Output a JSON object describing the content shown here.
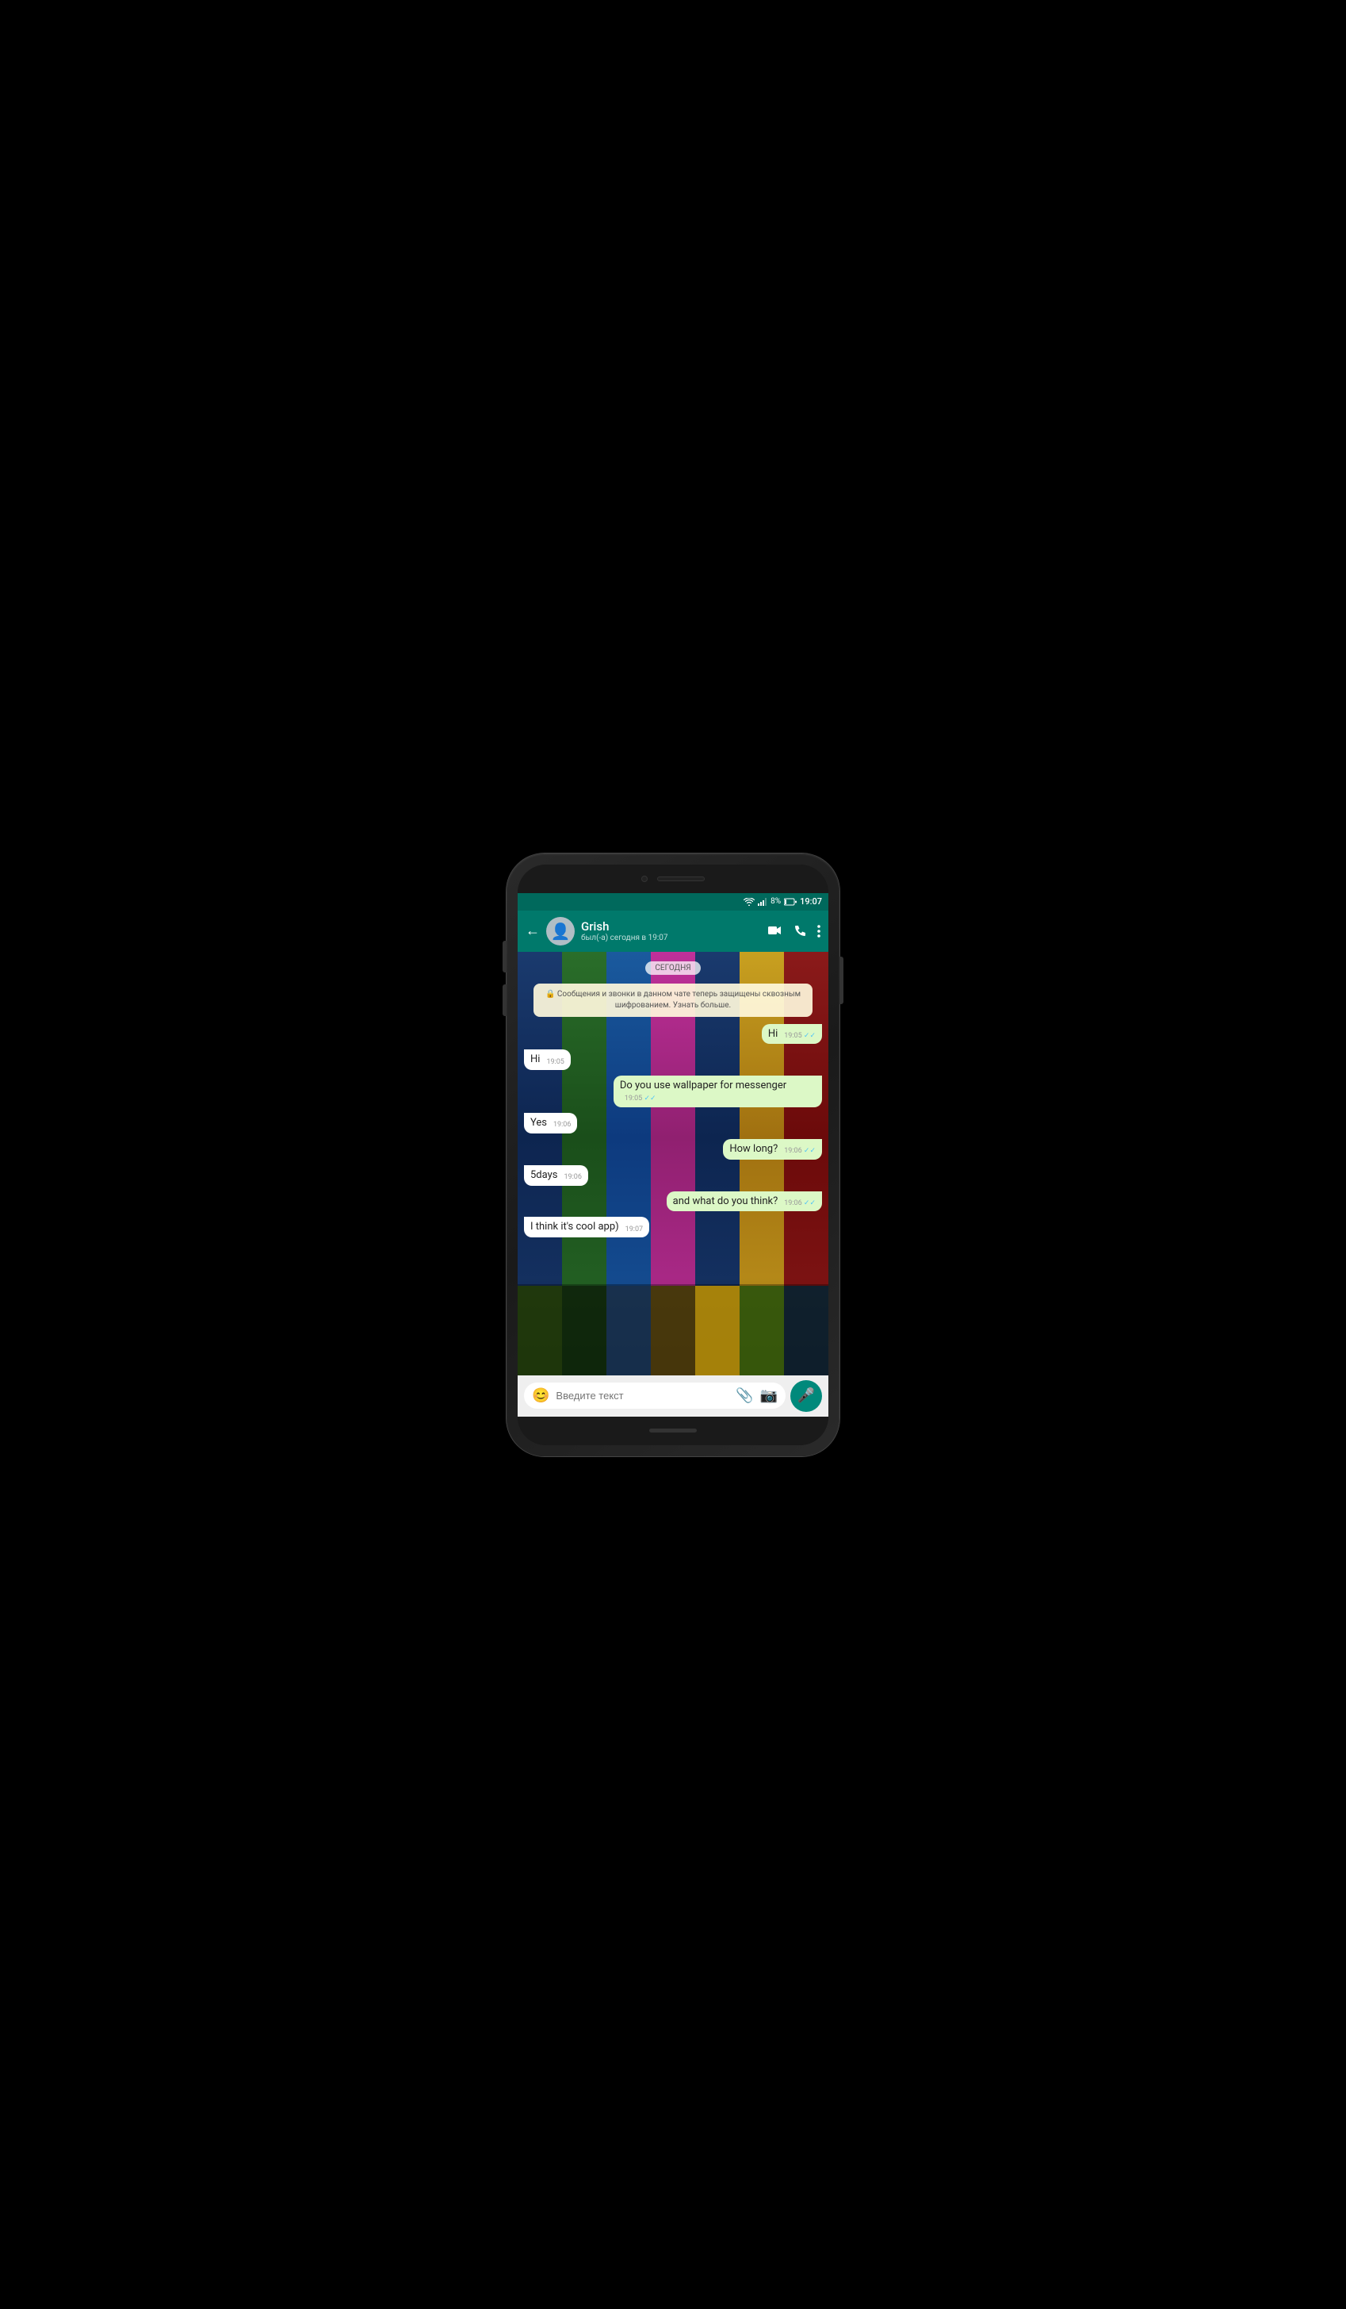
{
  "phone": {
    "statusBar": {
      "wifi": "wifi",
      "signal": "signal",
      "battery": "8%",
      "time": "19:07"
    },
    "header": {
      "backLabel": "←",
      "contactName": "Grish",
      "contactStatus": "был(-а) сегодня в 19:07",
      "videoIcon": "video-camera",
      "phoneIcon": "phone",
      "moreIcon": "more-vert"
    },
    "chat": {
      "dateBadge": "СЕГОДНЯ",
      "systemMessage": "🔒 Сообщения и звонки в данном чате теперь защищены сквозным шифрованием. Узнать больше.",
      "messages": [
        {
          "id": 1,
          "type": "outgoing",
          "text": "Hi",
          "time": "19:05",
          "ticks": "✓✓"
        },
        {
          "id": 2,
          "type": "incoming",
          "text": "Hi",
          "time": "19:05"
        },
        {
          "id": 3,
          "type": "outgoing",
          "text": "Do you use wallpaper for messenger",
          "time": "19:05",
          "ticks": "✓✓"
        },
        {
          "id": 4,
          "type": "incoming",
          "text": "Yes",
          "time": "19:06"
        },
        {
          "id": 5,
          "type": "outgoing",
          "text": "How long?",
          "time": "19:06",
          "ticks": "✓✓"
        },
        {
          "id": 6,
          "type": "incoming",
          "text": "5days",
          "time": "19:06"
        },
        {
          "id": 7,
          "type": "outgoing",
          "text": "and what do you think?",
          "time": "19:06",
          "ticks": "✓✓"
        },
        {
          "id": 8,
          "type": "incoming",
          "text": "I think it's cool app)",
          "time": "19:07"
        }
      ]
    },
    "inputBar": {
      "placeholder": "Введите текст",
      "emojiIcon": "😊",
      "attachIcon": "📎",
      "cameraIcon": "📷",
      "micIcon": "🎤"
    }
  }
}
